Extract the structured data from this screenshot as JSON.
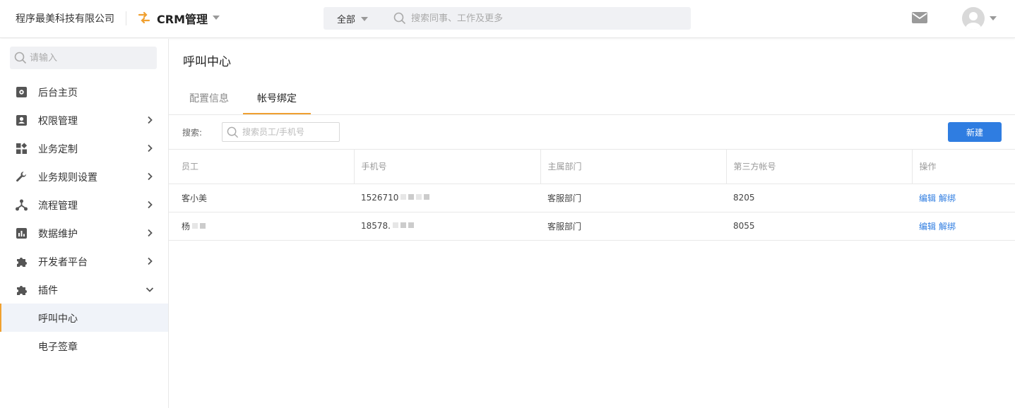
{
  "header": {
    "company": "程序最美科技有限公司",
    "app_title": "CRM管理",
    "search_scope": "全部",
    "search_placeholder": "搜索同事、工作及更多"
  },
  "sidebar": {
    "search_placeholder": "请输入",
    "items": [
      {
        "label": "后台主页",
        "icon": "settings-icon"
      },
      {
        "label": "权限管理",
        "icon": "user-card-icon"
      },
      {
        "label": "业务定制",
        "icon": "grid-icon"
      },
      {
        "label": "业务规则设置",
        "icon": "wrench-icon"
      },
      {
        "label": "流程管理",
        "icon": "flow-icon"
      },
      {
        "label": "数据维护",
        "icon": "chart-icon"
      },
      {
        "label": "开发者平台",
        "icon": "puzzle-icon"
      },
      {
        "label": "插件",
        "icon": "puzzle-icon"
      }
    ],
    "sub_items": [
      {
        "label": "呼叫中心"
      },
      {
        "label": "电子签章"
      }
    ]
  },
  "main": {
    "title": "呼叫中心",
    "tabs": [
      {
        "label": "配置信息"
      },
      {
        "label": "帐号绑定"
      }
    ],
    "filter_label": "搜索:",
    "filter_placeholder": "搜索员工/手机号",
    "new_button": "新建",
    "columns": [
      "员工",
      "手机号",
      "主属部门",
      "第三方帐号",
      "操作"
    ],
    "rows": [
      {
        "employee": "客小美",
        "phone": "1526710",
        "dept": "客服部门",
        "account": "8205",
        "edit": "编辑",
        "unbind": "解绑"
      },
      {
        "employee": "杨",
        "phone": "18578.",
        "dept": "客服部门",
        "account": "8055",
        "edit": "编辑",
        "unbind": "解绑"
      }
    ]
  },
  "colors": {
    "accent_orange": "#f0a030",
    "primary_blue": "#2f7de1"
  }
}
